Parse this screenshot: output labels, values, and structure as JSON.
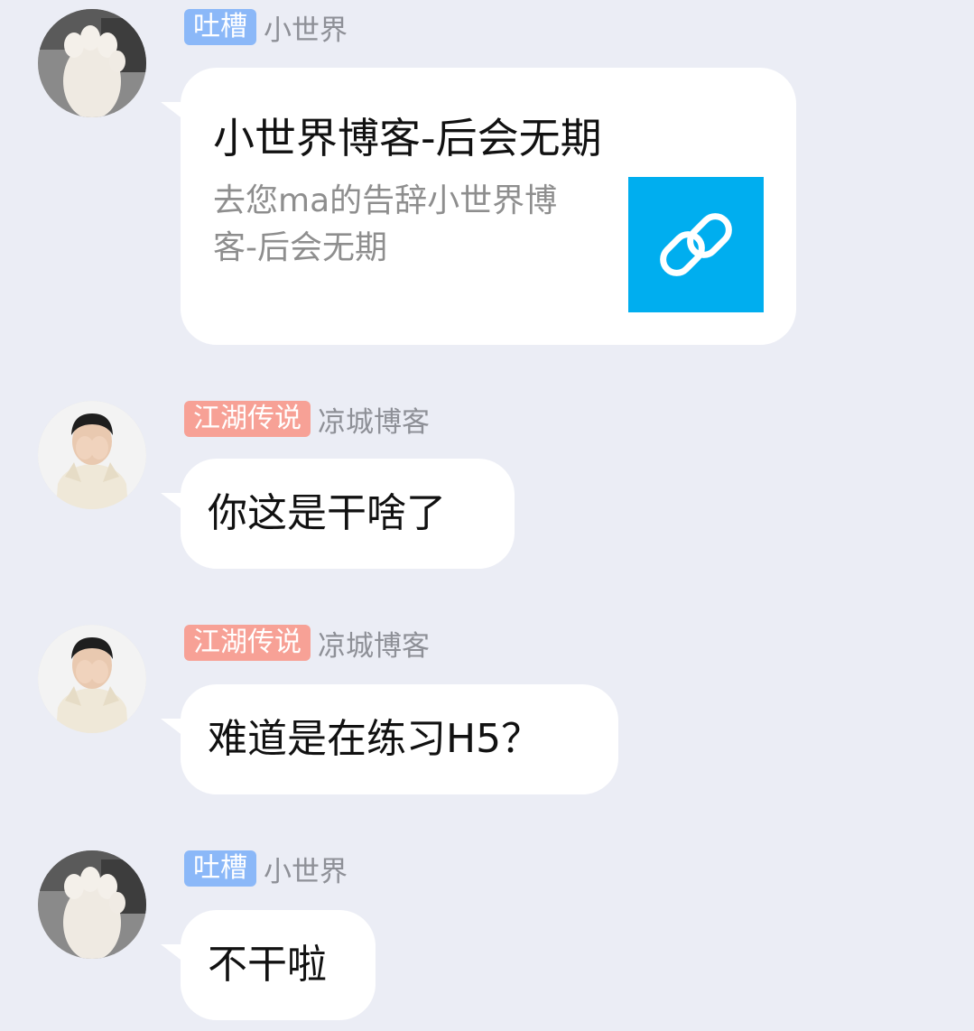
{
  "messages": [
    {
      "badge": "吐槽",
      "badge_color": "#8BB8F8",
      "sender": "小世界",
      "avatar": "cat-paw-avatar",
      "type": "link",
      "link": {
        "title": "小世界博客-后会无期",
        "description": "去您ma的告辞小世界博客-后会无期",
        "icon": "link-icon",
        "thumb_color": "#00AEEF"
      }
    },
    {
      "badge": "江湖传说",
      "badge_color": "#F7A196",
      "sender": "凉城博客",
      "avatar": "boy-covering-face-avatar",
      "type": "text",
      "text": "你这是干啥了"
    },
    {
      "badge": "江湖传说",
      "badge_color": "#F7A196",
      "sender": "凉城博客",
      "avatar": "boy-covering-face-avatar",
      "type": "text",
      "text": "难道是在练习H5？"
    },
    {
      "badge": "吐槽",
      "badge_color": "#8BB8F8",
      "sender": "小世界",
      "avatar": "cat-paw-avatar",
      "type": "text",
      "text": "不干啦"
    }
  ]
}
